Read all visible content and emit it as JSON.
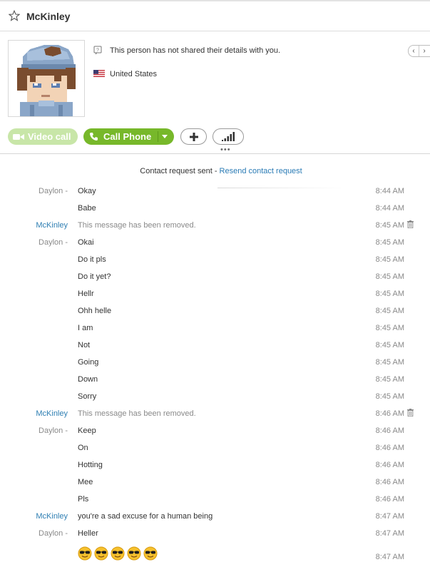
{
  "contact": {
    "name": "McKinley"
  },
  "profile": {
    "info_text": "This person has not shared their details with you.",
    "country": "United States",
    "flag_icon": "us-flag-icon"
  },
  "actions": {
    "video_call": "Video call",
    "call_phone": "Call Phone",
    "add_icon": "plus-icon",
    "signal_icon": "signal-bars-icon"
  },
  "notice": {
    "text": "Contact request sent - ",
    "link": "Resend contact request"
  },
  "messages": [
    {
      "sender": "Daylon -",
      "text": "Okay",
      "time": "8:44 AM"
    },
    {
      "sender": "",
      "text": "Babe",
      "time": "8:44 AM"
    },
    {
      "sender": "McKinley",
      "text": "This message has been removed.",
      "time": "8:45 AM",
      "removed": true
    },
    {
      "sender": "Daylon -",
      "text": "Okai",
      "time": "8:45 AM"
    },
    {
      "sender": "",
      "text": "Do it pls",
      "time": "8:45 AM"
    },
    {
      "sender": "",
      "text": "Do it yet?",
      "time": "8:45 AM"
    },
    {
      "sender": "",
      "text": "Hellr",
      "time": "8:45 AM"
    },
    {
      "sender": "",
      "text": "Ohh helle",
      "time": "8:45 AM"
    },
    {
      "sender": "",
      "text": "I am",
      "time": "8:45 AM"
    },
    {
      "sender": "",
      "text": "Not",
      "time": "8:45 AM"
    },
    {
      "sender": "",
      "text": "Going",
      "time": "8:45 AM"
    },
    {
      "sender": "",
      "text": "Down",
      "time": "8:45 AM"
    },
    {
      "sender": "",
      "text": "Sorry",
      "time": "8:45 AM"
    },
    {
      "sender": "McKinley",
      "text": "This message has been removed.",
      "time": "8:46 AM",
      "removed": true
    },
    {
      "sender": "Daylon -",
      "text": "Keep",
      "time": "8:46 AM"
    },
    {
      "sender": "",
      "text": "On",
      "time": "8:46 AM"
    },
    {
      "sender": "",
      "text": "Hotting",
      "time": "8:46 AM"
    },
    {
      "sender": "",
      "text": "Mee",
      "time": "8:46 AM"
    },
    {
      "sender": "",
      "text": "Pls",
      "time": "8:46 AM"
    },
    {
      "sender": "McKinley",
      "text": "you're a sad excuse for a human being",
      "time": "8:47 AM"
    },
    {
      "sender": "Daylon -",
      "text": "Heller",
      "time": "8:47 AM"
    }
  ],
  "emoji_message": {
    "emoji_icon": "sunglasses-face-icon",
    "count": 5,
    "time": "8:47 AM"
  }
}
